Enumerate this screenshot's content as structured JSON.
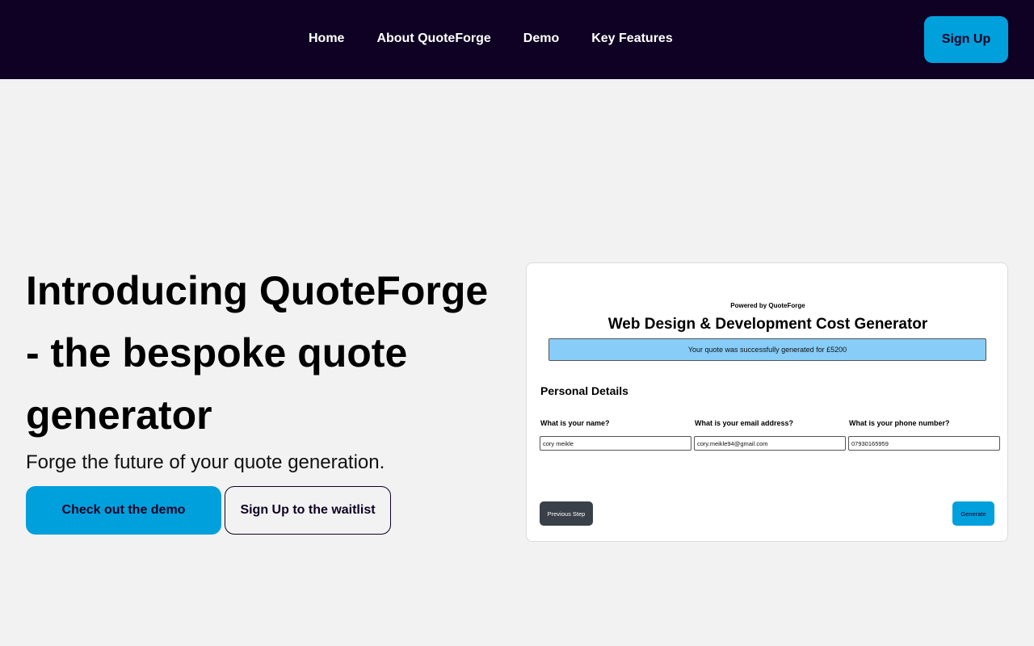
{
  "nav": {
    "links": [
      "Home",
      "About QuoteForge",
      "Demo",
      "Key Features"
    ],
    "signup_label": "Sign Up"
  },
  "hero": {
    "title": "Introducing QuoteForge - the bespoke quote generator",
    "subtitle": "Forge the future of your quote generation.",
    "demo_button": "Check out the demo",
    "waitlist_button": "Sign Up to the waitlist"
  },
  "preview": {
    "powered_by": "Powered by QuoteForge",
    "title": "Web Design & Development Cost Generator",
    "banner": "Your quote was successfully generated for £5200",
    "section_title": "Personal Details",
    "fields": [
      {
        "label": "What is your name?",
        "value": "cory meikle"
      },
      {
        "label": "What is your email address?",
        "value": "cory.meikle94@gmail.com"
      },
      {
        "label": "What is your phone number?",
        "value": "07930165959"
      }
    ],
    "previous_button": "Previous Step",
    "generate_button": "Generate"
  },
  "colors": {
    "nav_bg": "#0e0123",
    "accent": "#00a0dc",
    "page_bg": "#f2f2f2",
    "banner_bg": "#87cdf8"
  }
}
